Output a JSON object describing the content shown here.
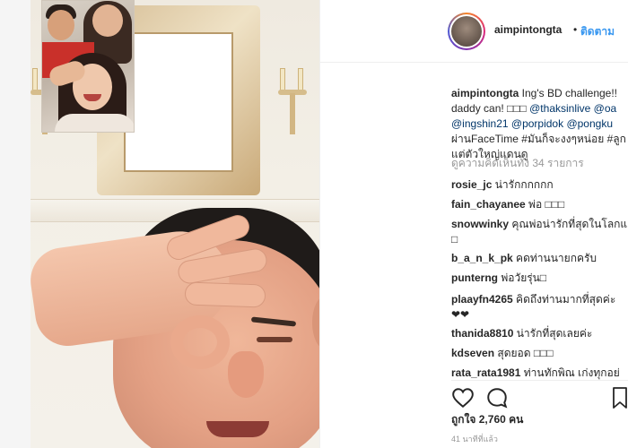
{
  "post": {
    "author": "aimpintongta",
    "follow_label": "ติดตาม",
    "separator": "•"
  },
  "caption": {
    "user": "aimpintongta",
    "line1_text": " Ing's BD challenge!!",
    "line2_text": "daddy can! □□□ ",
    "line2_mention1": "@thaksinlive",
    "line2_mention2": " @oa",
    "line3_mention1": "@ingshin21",
    "line3_mention2": " @porpidok",
    "line3_mention3": " @pongku",
    "line4": "ผ่านFaceTime #มันก็จะงงๆหน่อย #ลูก",
    "line5": "แต่ตัวใหญ่แดนดู"
  },
  "view_all": "ดูความคิดเห็นทั้ง 34 รายการ",
  "comments": [
    {
      "user": "rosie_jc",
      "text": " น่ารักกกกกก"
    },
    {
      "user": "fain_chayanee",
      "text": " พ่อ □□□"
    },
    {
      "user": "snowwinky",
      "text": " คุณพ่อน่ารักที่สุดในโลกแ",
      "cont": "□"
    },
    {
      "user": "b_a_n_k_pk",
      "text": " คดท่านนายกครับ"
    },
    {
      "user": "punterng",
      "text": " พ่อวัยรุ่น□"
    },
    {
      "user": "plaayfn4265",
      "text": " คิดถึงท่านมากที่สุดค่ะ",
      "cont": "❤❤"
    },
    {
      "user": "thanida8810",
      "text": " น่ารักที่สุดเลยค่ะ"
    },
    {
      "user": "kdseven",
      "text": " สุดยอด □□□"
    },
    {
      "user": "rata_rata1981",
      "text": " ท่านทักพิณ เก่งทุกอย่"
    }
  ],
  "likes": "ถูกใจ 2,760 คน",
  "timestamp": "41 นาทีที่แล้ว",
  "icons": {
    "like": "heart-icon",
    "comment": "comment-icon",
    "save": "bookmark-icon"
  },
  "colors": {
    "link": "#3897f0",
    "mention": "#003569",
    "muted": "#999999"
  }
}
